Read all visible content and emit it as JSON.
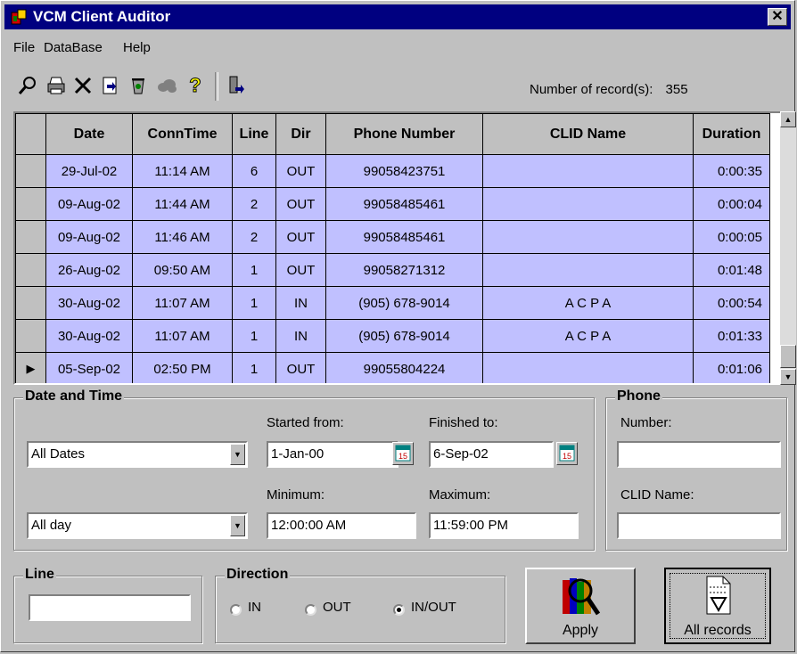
{
  "window": {
    "title": "VCM Client Auditor",
    "close_glyph": "✕"
  },
  "menu": [
    "File",
    "DataBase",
    "Help"
  ],
  "toolbar": {
    "icons": [
      "find-icon",
      "print-icon",
      "delete-icon",
      "export-icon",
      "recycle-icon",
      "cloud-icon",
      "help-icon",
      "exit-icon"
    ]
  },
  "record_count": {
    "label": "Number of record(s):",
    "value": "355"
  },
  "grid": {
    "columns": [
      "Date",
      "ConnTime",
      "Line",
      "Dir",
      "Phone Number",
      "CLID Name",
      "Duration"
    ],
    "rows": [
      [
        "29-Jul-02",
        "11:14 AM",
        "6",
        "OUT",
        "99058423751",
        "",
        "0:00:35"
      ],
      [
        "09-Aug-02",
        "11:44 AM",
        "2",
        "OUT",
        "99058485461",
        "",
        "0:00:04"
      ],
      [
        "09-Aug-02",
        "11:46 AM",
        "2",
        "OUT",
        "99058485461",
        "",
        "0:00:05"
      ],
      [
        "26-Aug-02",
        "09:50 AM",
        "1",
        "OUT",
        "99058271312",
        "",
        "0:01:48"
      ],
      [
        "30-Aug-02",
        "11:07 AM",
        "1",
        "IN",
        "(905) 678-9014",
        "A C P A",
        "0:00:54"
      ],
      [
        "30-Aug-02",
        "11:07 AM",
        "1",
        "IN",
        "(905) 678-9014",
        "A C P A",
        "0:01:33"
      ],
      [
        "05-Sep-02",
        "02:50 PM",
        "1",
        "OUT",
        "99055804224",
        "",
        "0:01:06"
      ]
    ],
    "current_row_marker": "▶",
    "current_row_index": 6,
    "row_color": "#c0c0ff"
  },
  "date_time": {
    "title": "Date and Time",
    "dates_combo": "All Dates",
    "started_label": "Started from:",
    "started_value": "1-Jan-00",
    "finished_label": "Finished to:",
    "finished_value": "6-Sep-02",
    "day_combo": "All day",
    "min_label": "Minimum:",
    "min_value": "12:00:00 AM",
    "max_label": "Maximum:",
    "max_value": "11:59:00 PM"
  },
  "phone": {
    "title": "Phone",
    "number_label": "Number:",
    "number_value": "",
    "clid_label": "CLID Name:",
    "clid_value": ""
  },
  "line": {
    "title": "Line",
    "value": ""
  },
  "direction": {
    "title": "Direction",
    "options": [
      "IN",
      "OUT",
      "IN/OUT"
    ],
    "selected": "IN/OUT"
  },
  "buttons": {
    "apply": "Apply",
    "all_records": "All records"
  }
}
